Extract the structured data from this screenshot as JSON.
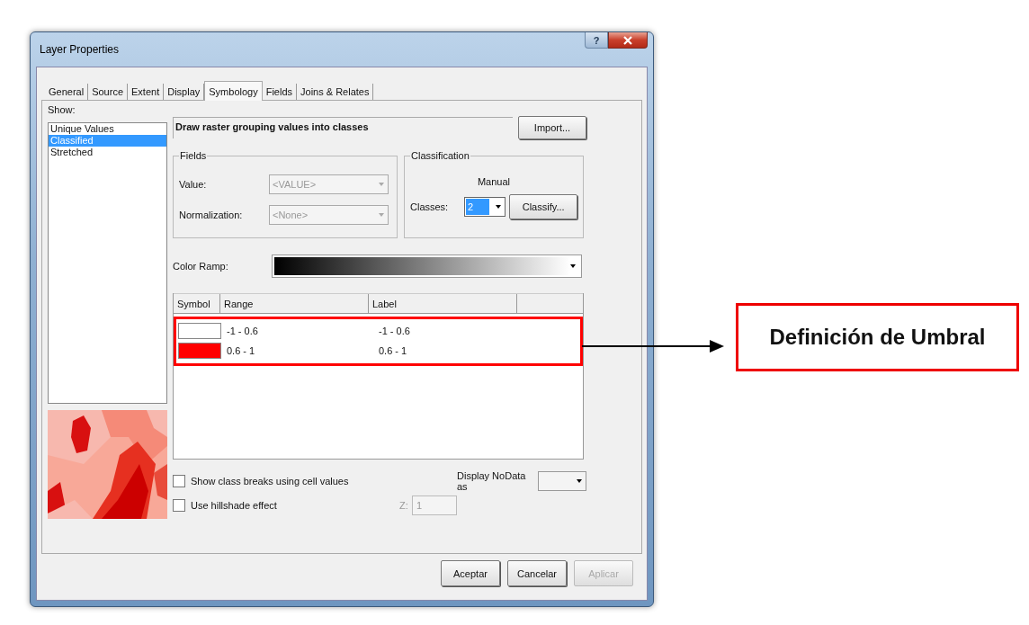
{
  "window": {
    "title": "Layer Properties",
    "help_button": "?"
  },
  "tabs": [
    {
      "label": "General",
      "selected": false
    },
    {
      "label": "Source",
      "selected": false
    },
    {
      "label": "Extent",
      "selected": false
    },
    {
      "label": "Display",
      "selected": false
    },
    {
      "label": "Symbology",
      "selected": true
    },
    {
      "label": "Fields",
      "selected": false
    },
    {
      "label": "Joins & Relates",
      "selected": false
    }
  ],
  "show": {
    "label": "Show:",
    "items": [
      {
        "label": "Unique Values",
        "selected": false
      },
      {
        "label": "Classified",
        "selected": true
      },
      {
        "label": "Stretched",
        "selected": false
      }
    ]
  },
  "description": "Draw raster grouping values into classes",
  "import_button": "Import...",
  "fields": {
    "title": "Fields",
    "rows": [
      {
        "label": "Value:",
        "value": "<VALUE>",
        "disabled": true
      },
      {
        "label": "Normalization:",
        "value": "<None>",
        "disabled": true
      }
    ]
  },
  "classification": {
    "title": "Classification",
    "method": "Manual",
    "classes_label": "Classes:",
    "classes_value": "2",
    "classes_value_highlighted": true,
    "classify_button": "Classify..."
  },
  "color_ramp": {
    "label": "Color Ramp:"
  },
  "table": {
    "columns": [
      "Symbol",
      "Range",
      "Label"
    ],
    "rows": [
      {
        "color": "#ffffff",
        "range": "-1 - 0.6",
        "label": "-1 - 0.6"
      },
      {
        "color": "#ff0000",
        "range": "0.6 - 1",
        "label": "0.6 - 1"
      }
    ]
  },
  "options": [
    {
      "label": "Show class breaks using cell values",
      "checked": false
    },
    {
      "label": "Use hillshade effect",
      "checked": false
    }
  ],
  "z_field": {
    "label": "Z:",
    "value": "1",
    "disabled": true
  },
  "nodata": {
    "label": "Display NoData as"
  },
  "buttons": [
    {
      "label": "Aceptar",
      "disabled": false
    },
    {
      "label": "Cancelar",
      "disabled": false
    },
    {
      "label": "Aplicar",
      "disabled": true
    }
  ],
  "annotation": {
    "text": "Definición de Umbral"
  }
}
